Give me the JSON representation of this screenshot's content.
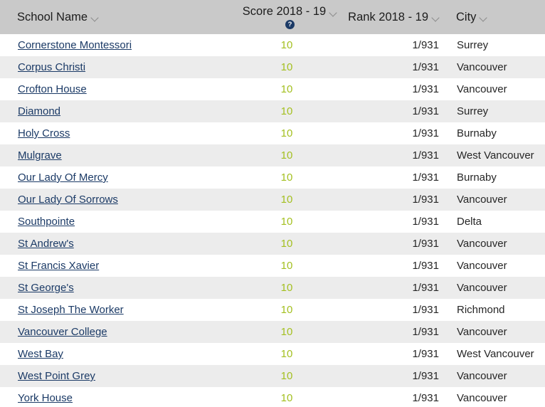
{
  "table": {
    "columns": [
      {
        "key": "school_name",
        "label": "School Name",
        "sortable": true,
        "help": false
      },
      {
        "key": "score",
        "label": "Score 2018 - 19",
        "sortable": true,
        "help": true,
        "help_glyph": "?"
      },
      {
        "key": "rank",
        "label": "Rank 2018 - 19",
        "sortable": true,
        "help": false
      },
      {
        "key": "city",
        "label": "City",
        "sortable": true,
        "help": false
      }
    ],
    "headers": {
      "school_name": "School Name",
      "score": "Score 2018 - 19",
      "rank": "Rank 2018 - 19",
      "city": "City",
      "help_glyph": "?"
    },
    "colors": {
      "header_bg": "#c9c9c9",
      "row_alt_bg": "#ececec",
      "row_bg": "#ffffff",
      "link": "#1b3a66",
      "score": "#a4c021",
      "text": "#262626",
      "help_badge": "#1b3a66"
    },
    "rows": [
      {
        "school_name": "Cornerstone Montessori",
        "score": "10",
        "rank": "1/931",
        "city": "Surrey"
      },
      {
        "school_name": "Corpus Christi",
        "score": "10",
        "rank": "1/931",
        "city": "Vancouver"
      },
      {
        "school_name": "Crofton House",
        "score": "10",
        "rank": "1/931",
        "city": "Vancouver"
      },
      {
        "school_name": "Diamond",
        "score": "10",
        "rank": "1/931",
        "city": "Surrey"
      },
      {
        "school_name": "Holy Cross",
        "score": "10",
        "rank": "1/931",
        "city": "Burnaby"
      },
      {
        "school_name": "Mulgrave",
        "score": "10",
        "rank": "1/931",
        "city": "West Vancouver"
      },
      {
        "school_name": "Our Lady Of Mercy",
        "score": "10",
        "rank": "1/931",
        "city": "Burnaby"
      },
      {
        "school_name": "Our Lady Of Sorrows",
        "score": "10",
        "rank": "1/931",
        "city": "Vancouver"
      },
      {
        "school_name": "Southpointe",
        "score": "10",
        "rank": "1/931",
        "city": "Delta"
      },
      {
        "school_name": "St Andrew's",
        "score": "10",
        "rank": "1/931",
        "city": "Vancouver"
      },
      {
        "school_name": "St Francis Xavier",
        "score": "10",
        "rank": "1/931",
        "city": "Vancouver"
      },
      {
        "school_name": "St George's",
        "score": "10",
        "rank": "1/931",
        "city": "Vancouver"
      },
      {
        "school_name": "St Joseph The Worker",
        "score": "10",
        "rank": "1/931",
        "city": "Richmond"
      },
      {
        "school_name": "Vancouver College",
        "score": "10",
        "rank": "1/931",
        "city": "Vancouver"
      },
      {
        "school_name": "West Bay",
        "score": "10",
        "rank": "1/931",
        "city": "West Vancouver"
      },
      {
        "school_name": "West Point Grey",
        "score": "10",
        "rank": "1/931",
        "city": "Vancouver"
      },
      {
        "school_name": "York House",
        "score": "10",
        "rank": "1/931",
        "city": "Vancouver"
      }
    ],
    "icons": {
      "sort_chevron": "chevron-down-icon",
      "help": "question-mark-circle-icon"
    }
  }
}
